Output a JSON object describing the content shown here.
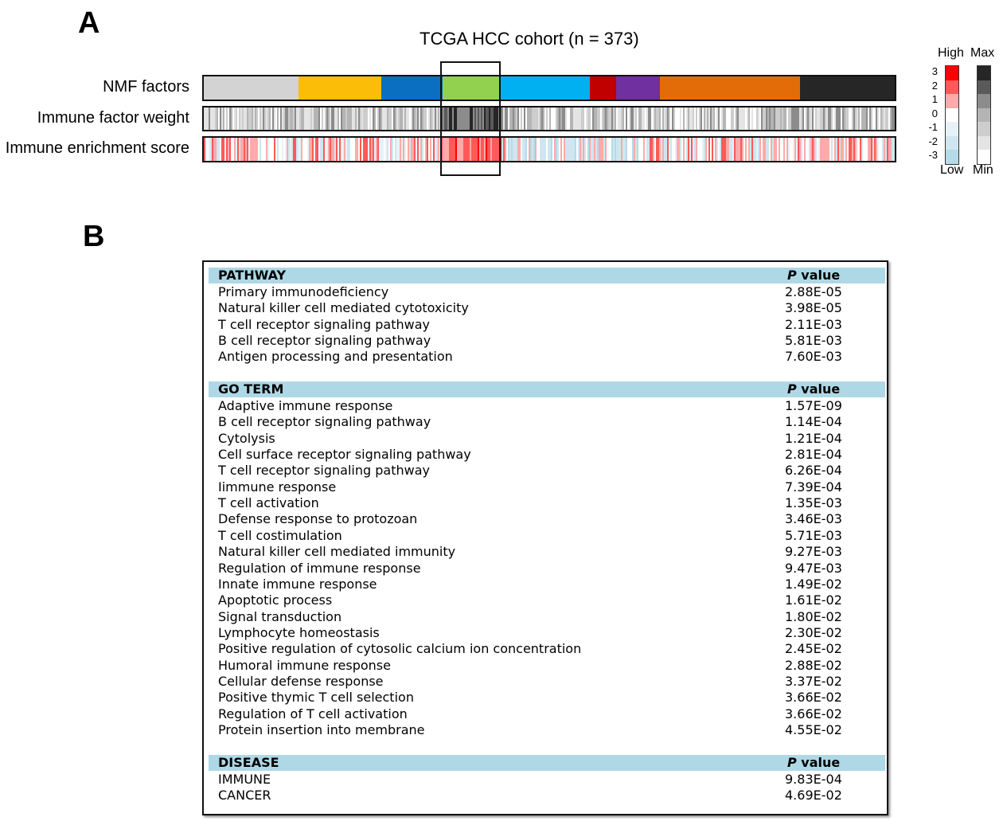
{
  "panels": {
    "a": "A",
    "b": "B"
  },
  "heatmap": {
    "title": "TCGA HCC cohort (n = 373)",
    "rows": [
      {
        "label": "NMF factors"
      },
      {
        "label": "Immune factor weight"
      },
      {
        "label": "Immune enrichment score"
      }
    ],
    "nmf_factor_colors": [
      "#d3d3d3",
      "#fbbd08",
      "#0a6ec1",
      "#92d050",
      "#00b0f0",
      "#c00000",
      "#7030a0",
      "#e36c09",
      "#262626"
    ],
    "legend": {
      "high_label": "High",
      "low_label": "Low",
      "max_label": "Max",
      "min_label": "Min",
      "ticks": [
        "3",
        "2",
        "1",
        "0",
        "-1",
        "-2",
        "-3"
      ],
      "red_scale": [
        "#ff0000",
        "#ff5959",
        "#ffaaaa",
        "#ffffff",
        "#e6f2f8",
        "#cfe6f0",
        "#b5dbe9"
      ],
      "gray_scale": [
        "#262626",
        "#5a5a5a",
        "#8c8c8c",
        "#b4b4b4",
        "#cdcdcd",
        "#e4e4e4",
        "#ffffff"
      ]
    }
  },
  "table": {
    "sections": [
      {
        "header": "PATHWAY",
        "p_label_italic": "P",
        "p_label_rest": " value",
        "rows": [
          {
            "term": "Primary immunodeficiency",
            "p": "2.88E-05"
          },
          {
            "term": "Natural killer cell mediated cytotoxicity",
            "p": "3.98E-05"
          },
          {
            "term": "T cell receptor signaling pathway",
            "p": "2.11E-03"
          },
          {
            "term": "B cell receptor signaling pathway",
            "p": "5.81E-03"
          },
          {
            "term": "Antigen processing and presentation",
            "p": "7.60E-03"
          }
        ]
      },
      {
        "header": "GO TERM",
        "p_label_italic": "P",
        "p_label_rest": " value",
        "rows": [
          {
            "term": "Adaptive immune response",
            "p": "1.57E-09"
          },
          {
            "term": "B cell receptor signaling pathway",
            "p": "1.14E-04"
          },
          {
            "term": "Cytolysis",
            "p": "1.21E-04"
          },
          {
            "term": "Cell surface receptor signaling pathway",
            "p": "2.81E-04"
          },
          {
            "term": "T cell receptor signaling pathway",
            "p": "6.26E-04"
          },
          {
            "term": "Iimmune response",
            "p": "7.39E-04"
          },
          {
            "term": "T cell activation",
            "p": "1.35E-03"
          },
          {
            "term": "Defense response to protozoan",
            "p": "3.46E-03"
          },
          {
            "term": "T cell costimulation",
            "p": "5.71E-03"
          },
          {
            "term": "Natural killer cell mediated immunity",
            "p": "9.27E-03"
          },
          {
            "term": "Regulation of immune response",
            "p": "9.47E-03"
          },
          {
            "term": "Innate immune response",
            "p": "1.49E-02"
          },
          {
            "term": "Apoptotic process",
            "p": "1.61E-02"
          },
          {
            "term": "Signal transduction",
            "p": "1.80E-02"
          },
          {
            "term": "Lymphocyte homeostasis",
            "p": "2.30E-02"
          },
          {
            "term": "Positive regulation of cytosolic calcium ion concentration",
            "p": "2.45E-02"
          },
          {
            "term": "Humoral immune response",
            "p": "2.88E-02"
          },
          {
            "term": "Cellular defense response",
            "p": "3.37E-02"
          },
          {
            "term": "Positive thymic T cell selection",
            "p": "3.66E-02"
          },
          {
            "term": "Regulation of T cell activation",
            "p": "3.66E-02"
          },
          {
            "term": "Protein insertion into membrane",
            "p": "4.55E-02"
          }
        ]
      },
      {
        "header": "DISEASE",
        "p_label_italic": "P",
        "p_label_rest": " value",
        "rows": [
          {
            "term": "IMMUNE",
            "p": "9.83E-04"
          },
          {
            "term": "CANCER",
            "p": "4.69E-02"
          }
        ]
      }
    ]
  }
}
